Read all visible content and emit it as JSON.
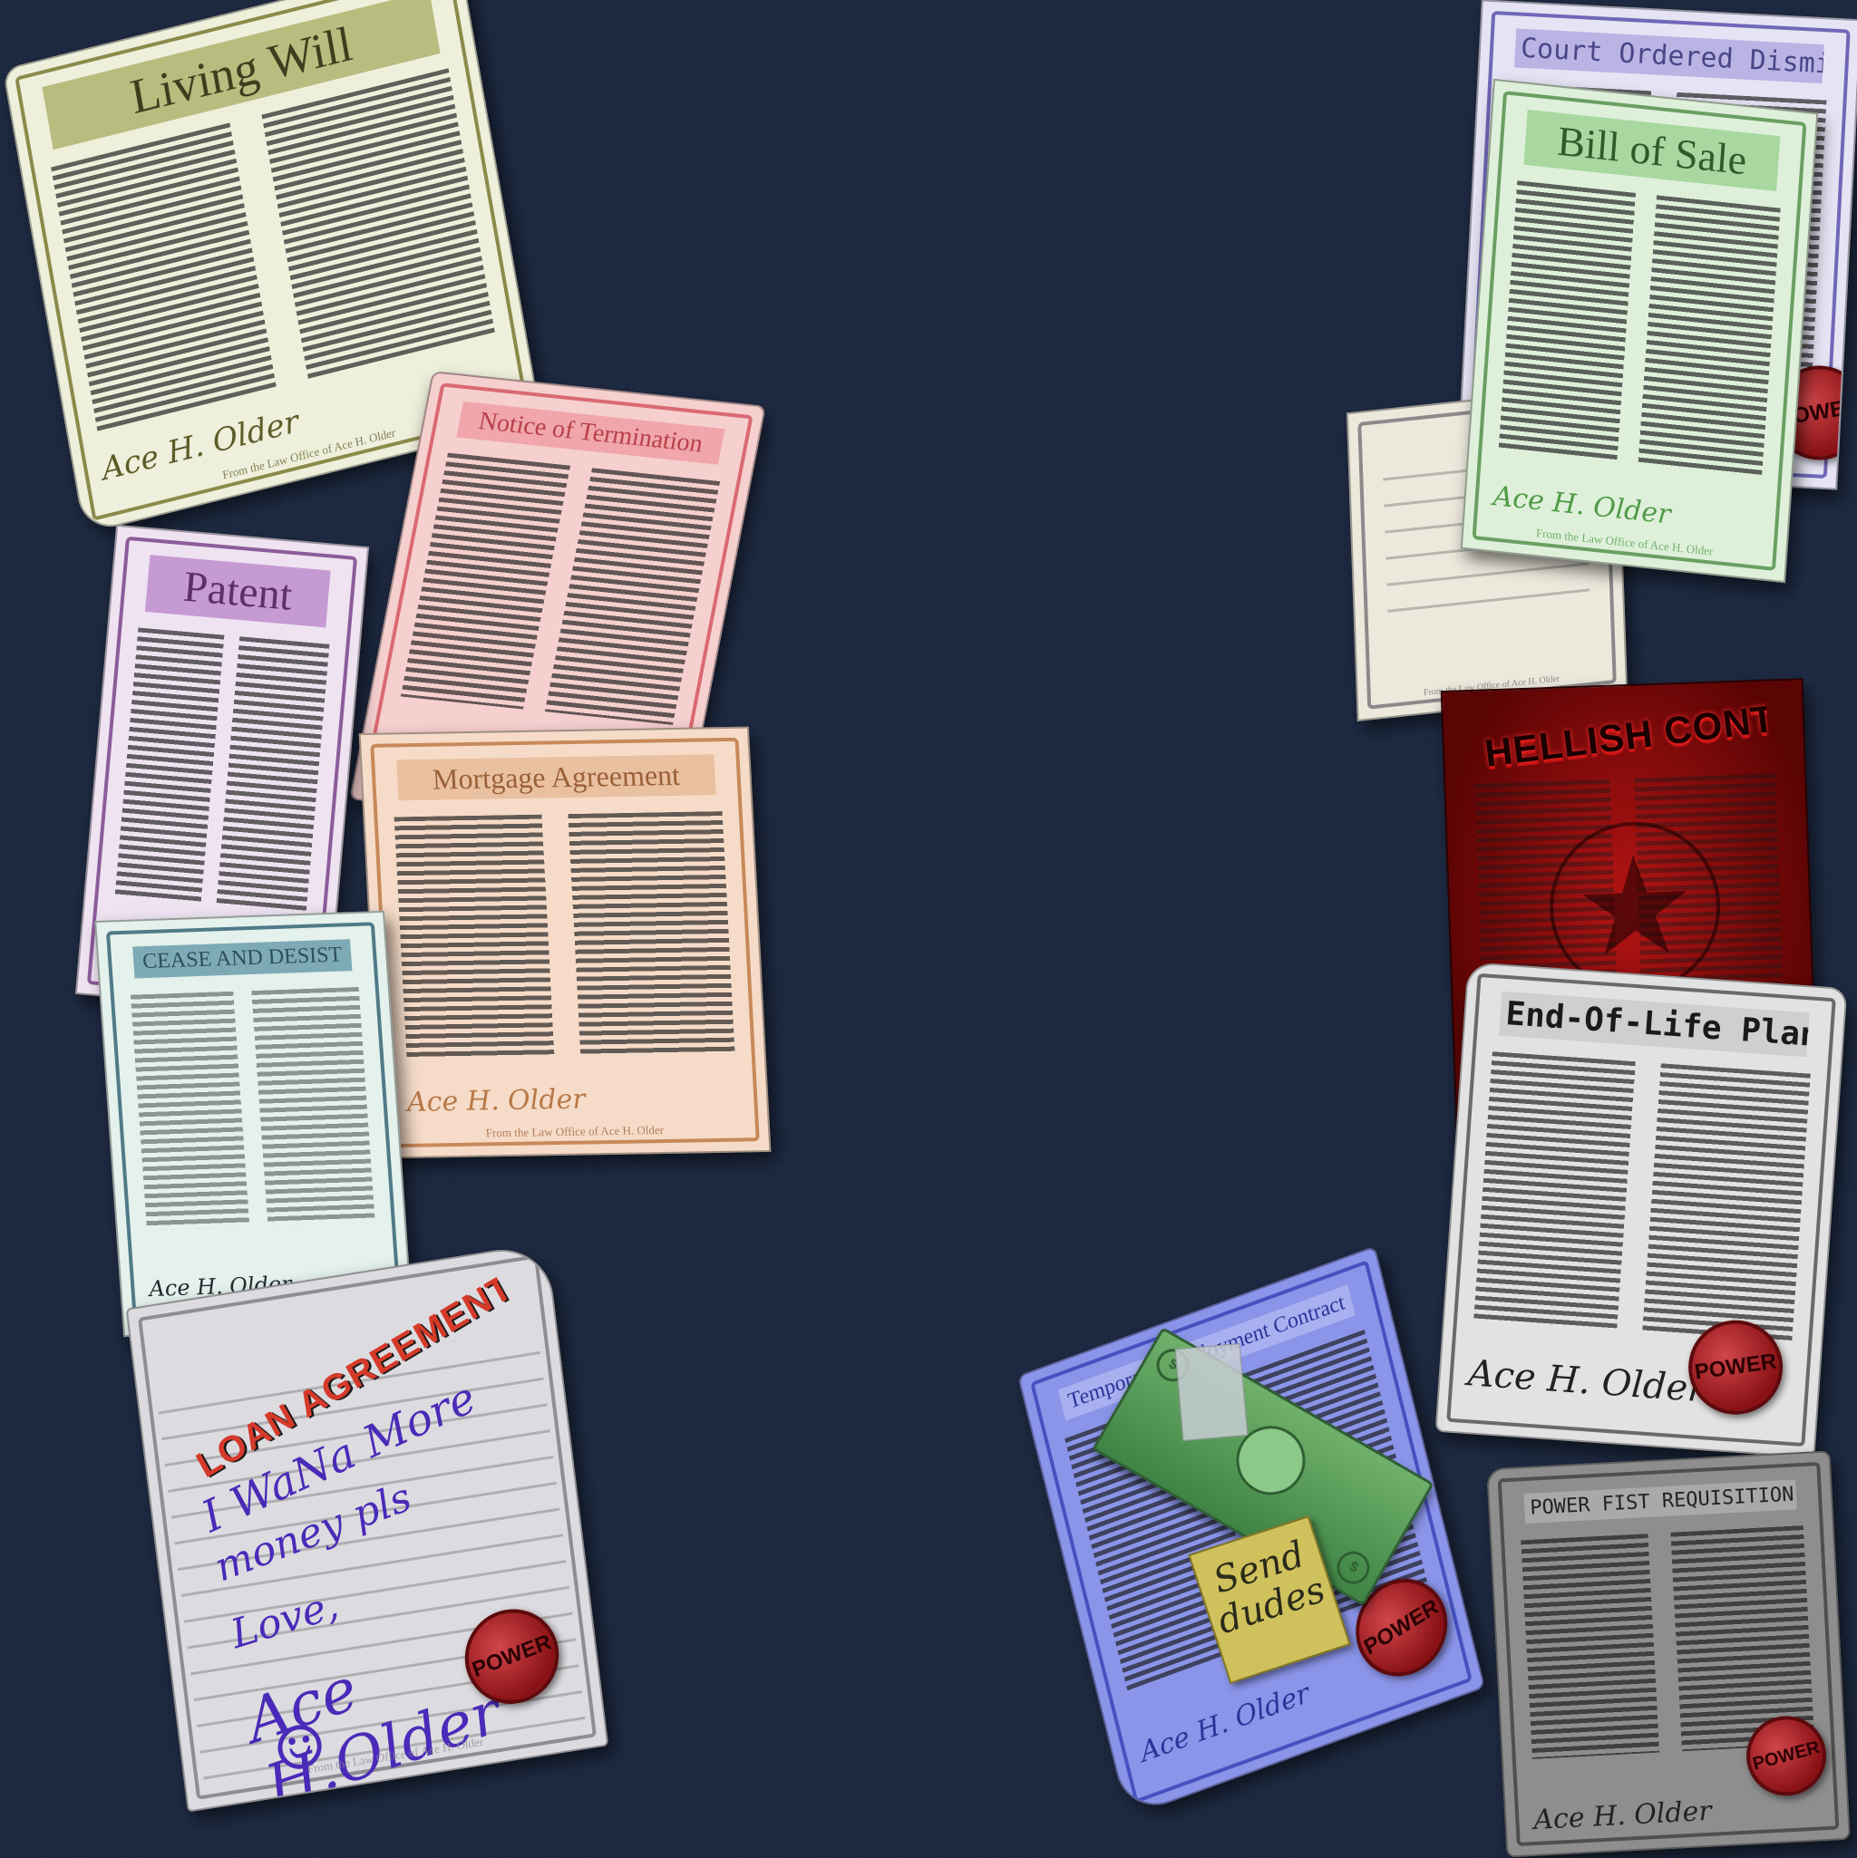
{
  "footer_text": "From the Law Office of Ace H. Older",
  "signature": "Ace H. Older",
  "stamp_label": "POWER",
  "documents": {
    "living_will": {
      "title": "Living Will",
      "paper": "#eef0dc",
      "accent": "#8a8a4a",
      "banner": "#b8bc7e"
    },
    "notice_of_termination": {
      "title": "Notice of Termination",
      "paper": "#f6cfcf",
      "accent": "#d96a72",
      "banner": "#f0a6aa"
    },
    "patent": {
      "title": "Patent",
      "paper": "#efe3f2",
      "accent": "#8c5c9a",
      "banner": "#c69bd4"
    },
    "mortgage_agreement": {
      "title": "Mortgage Agreement",
      "paper": "#f6dcc8",
      "accent": "#c8895a",
      "banner": "#e9c0a0"
    },
    "cease_and_desist": {
      "title": "CEASE AND DESIST",
      "paper": "#e4f1ec",
      "accent": "#4f7a88",
      "banner": "#7eaab6"
    },
    "loan_agreement": {
      "title": "LOAN AGREEMENT",
      "paper": "#dcdce0",
      "accent": "#8d8d93",
      "note_line_1": "I WaNa More",
      "note_line_2": "money pls",
      "note_line_3": "Love,",
      "note_signature": "Ace H.Older",
      "smiley": "☺"
    },
    "court_ordered_dismissal": {
      "title": "Court Ordered Dismissal",
      "paper": "#e6e4f4",
      "accent": "#6f68b8",
      "banner": "#b9b4e4"
    },
    "bill_of_sale": {
      "title": "Bill of Sale",
      "paper": "#def0da",
      "accent": "#6aa062",
      "banner": "#a8d8a0"
    },
    "blank_form": {
      "paper": "#ece8dc",
      "accent": "#8a8a8a"
    },
    "hellish_contract": {
      "title": "HELLISH CONTRACT",
      "paper": "#6e0606",
      "accent": "#d01818"
    },
    "end_of_life_plan": {
      "title": "End-Of-Life Plan",
      "paper": "#e2e2e2",
      "accent": "#6a6a6a",
      "banner": "#cfcfcf"
    },
    "temporary_employment_contract": {
      "title": "Temporary Employment Contract",
      "paper": "#8a94e8",
      "accent": "#4651c0",
      "banner": "#a8b0f0",
      "sticky_note_line_1": "Send",
      "sticky_note_line_2": "dudes",
      "bill_symbol": "$"
    },
    "power_fist_requisition": {
      "title": "POWER FIST REQUISITION",
      "paper": "#8e8e8e",
      "accent": "#4f4f4f",
      "banner": "#a9a9a9"
    }
  }
}
